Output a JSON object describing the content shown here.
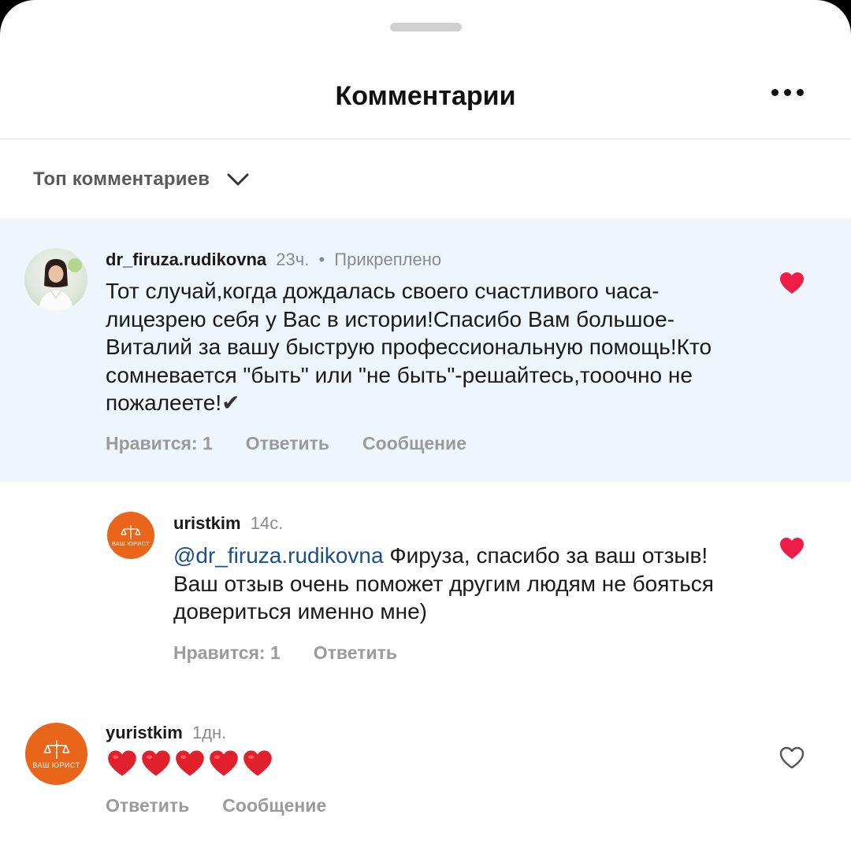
{
  "header": {
    "title": "Комментарии"
  },
  "sort": {
    "label": "Топ комментариев"
  },
  "comments": [
    {
      "username": "dr_firuza.rudikovna",
      "time": "23ч.",
      "pinned_label": "Прикреплено",
      "text": "Тот случай,когда дождалась своего счастливого часа-лицезрею себя у Вас в истории!Спасибо Вам большое-Виталий за вашу быструю профессиональную помощь!Кто сомневается \"быть\" или \"не быть\"-решайтесь,тооочно не пожалеете!",
      "text_end": "✔",
      "likes_label": "Нравится: 1",
      "reply_label": "Ответить",
      "message_label": "Сообщение",
      "liked": true
    },
    {
      "username": "uristkim",
      "time": "14с.",
      "mention": "@dr_firuza.rudikovna",
      "text": "Фируза, спасибо за ваш отзыв! Ваш отзыв очень поможет другим людям не бояться довериться именно мне)",
      "likes_label": "Нравится: 1",
      "reply_label": "Ответить",
      "liked": true
    },
    {
      "username": "yuristkim",
      "time": "1дн.",
      "emoji_text": "❤️❤️❤️❤️❤️",
      "reply_label": "Ответить",
      "message_label": "Сообщение",
      "liked": false
    }
  ],
  "brand_avatar": {
    "text": "ВАШ ЮРИСТ"
  },
  "colors": {
    "pinned_background": "#eef6fb",
    "like_red": "#ee1d48",
    "mention_blue": "#1c4e8a",
    "brand_orange": "#e8651a"
  },
  "icons": [
    "more-icon",
    "chevron-down-icon",
    "heart-filled-icon",
    "heart-outline-icon",
    "red-heart-emoji"
  ]
}
